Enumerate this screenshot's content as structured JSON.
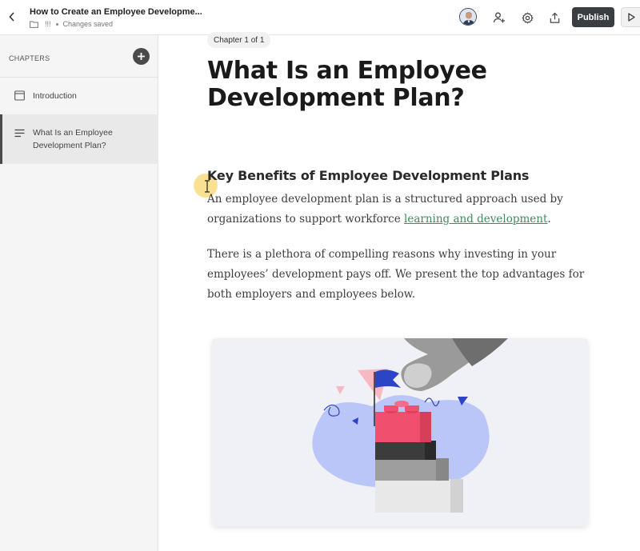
{
  "topbar": {
    "title": "How to Create an Employee Developme...",
    "folder_label": "!!!",
    "save_status": "Changes saved",
    "publish_label": "Publish"
  },
  "sidebar": {
    "header": "CHAPTERS",
    "items": [
      {
        "label": "Introduction",
        "icon": "page-icon",
        "active": false
      },
      {
        "label": "What Is an Employee Development Plan?",
        "icon": "text-lines-icon",
        "active": true
      }
    ]
  },
  "main": {
    "chapter_pill": "Chapter 1 of 1",
    "title": "What Is an Employee Development Plan?",
    "section_heading": "Key Benefits of Employee Development Plans",
    "paragraph1_before": "An employee development plan is a structured approach used by organizations to support workforce ",
    "paragraph1_link": "learning and development",
    "paragraph1_after": ".",
    "paragraph2": "There is a plethora of compelling reasons why investing in your employees’ development pays off. We present the top advantages for both employers and employees below."
  },
  "colors": {
    "publish_bg": "#3a3d42",
    "link": "#3f8a5c",
    "sidebar_bg": "#f5f5f5",
    "blob": "#b9c6f7",
    "brick_red": "#f0506e"
  },
  "icons": [
    "chevron-left-icon",
    "folder-icon",
    "add-user-icon",
    "gear-icon",
    "share-icon",
    "play-icon",
    "plus-icon"
  ]
}
